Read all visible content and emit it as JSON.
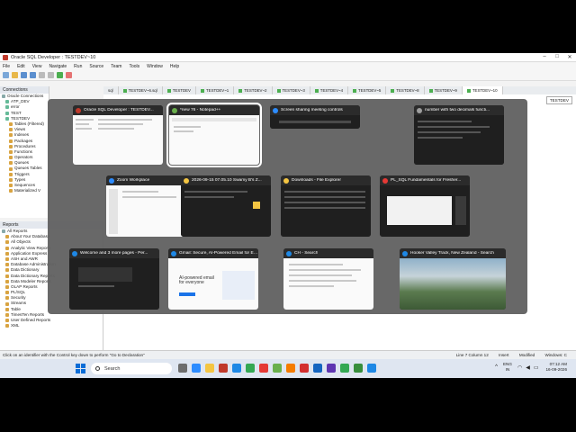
{
  "window": {
    "title": "Oracle SQL Developer : TESTDEV~10"
  },
  "menu": [
    "File",
    "Edit",
    "View",
    "Navigate",
    "Run",
    "Source",
    "Team",
    "Tools",
    "Window",
    "Help"
  ],
  "connections": {
    "header": "Connections",
    "items": [
      "Oracle Connections",
      "ATP_DEV",
      "error",
      "TEST",
      "TESTDEV",
      "Tables (Filtered)",
      "Views",
      "Indexes",
      "Packages",
      "Procedures",
      "Functions",
      "Operators",
      "Queues",
      "Queues Tables",
      "Triggers",
      "Types",
      "Sequences",
      "Materialized V"
    ]
  },
  "reports": {
    "header": "Reports",
    "items": [
      "All Reports",
      "About Your Database",
      "All Objects",
      "Analytic View Reports",
      "Application Express",
      "ASH and AWR",
      "Database Administration",
      "Data Dictionary",
      "Data Dictionary Reports",
      "Data Modeler Reports",
      "OLAP Reports",
      "PL/SQL",
      "Security",
      "Streams",
      "Table",
      "TimesTen Reports",
      "User Defined Reports",
      "XML"
    ]
  },
  "editor_tabs": [
    "sql",
    "TESTDEV~6.sql",
    "TESTDEV",
    "TESTDEV~1",
    "TESTDEV~2",
    "TESTDEV~3",
    "TESTDEV~4",
    "TESTDEV~5",
    "TESTDEV~8",
    "TESTDEV~9",
    "TESTDEV~10"
  ],
  "right_connection": "TESTDEV",
  "status": {
    "left": "Click on an identifier with the Control key down to perform \"Go to Declaration\"",
    "position": "Line 7 Column 12",
    "mode": "Insert",
    "state": "Modified",
    "line_ending": "Windows: C"
  },
  "taskbar": {
    "search_placeholder": "Search",
    "language": "ENG",
    "region": "IN",
    "time": "07:12 AM",
    "date": "16-09-2026"
  },
  "switcher": {
    "windows": [
      {
        "title": "Oracle SQL Developer : TESTDEV...",
        "icon_color": "#c0392b",
        "theme": "light",
        "selected": false
      },
      {
        "title": "*new 76 - Notepad++",
        "icon_color": "#6ab04c",
        "theme": "light",
        "selected": true
      },
      {
        "title": "Screen sharing meeting controls",
        "icon_color": "#2d8cff",
        "theme": "dark",
        "selected": false
      },
      {
        "title": "number with two decimals functi...",
        "icon_color": "#9e9e9e",
        "theme": "dark",
        "selected": false
      },
      {
        "title": "Zoom Workplace",
        "icon_color": "#2d8cff",
        "theme": "light",
        "selected": false
      },
      {
        "title": "2026-09-15 07.05.10 Swamy B's Z...",
        "icon_color": "#f4c542",
        "theme": "dark",
        "selected": false
      },
      {
        "title": "Downloads - File Explorer",
        "icon_color": "#f4c542",
        "theme": "dark",
        "selected": false
      },
      {
        "title": "PL_SQL Fundamentals for Fresher...",
        "icon_color": "#e53935",
        "theme": "dark",
        "selected": false
      },
      {
        "title": "Welcome and 3 more pages - Per...",
        "icon_color": "#1e88e5",
        "theme": "dark",
        "selected": false
      },
      {
        "title": "Gmail: Secure, AI-Powered Email for Every...",
        "icon_color": "#1e88e5",
        "theme": "light",
        "selected": false
      },
      {
        "title": "CH - Search",
        "icon_color": "#1e88e5",
        "theme": "light",
        "selected": false
      },
      {
        "title": "Hooker Valley Track, New Zealand - Search",
        "icon_color": "#1e88e5",
        "theme": "photo",
        "selected": false
      }
    ],
    "gmail_thumb_text": "AI-powered email for everyone"
  },
  "colors": {
    "accent": "#0a6cd6",
    "switcher_bg": "#626262",
    "selected_outline": "#ffffff"
  }
}
